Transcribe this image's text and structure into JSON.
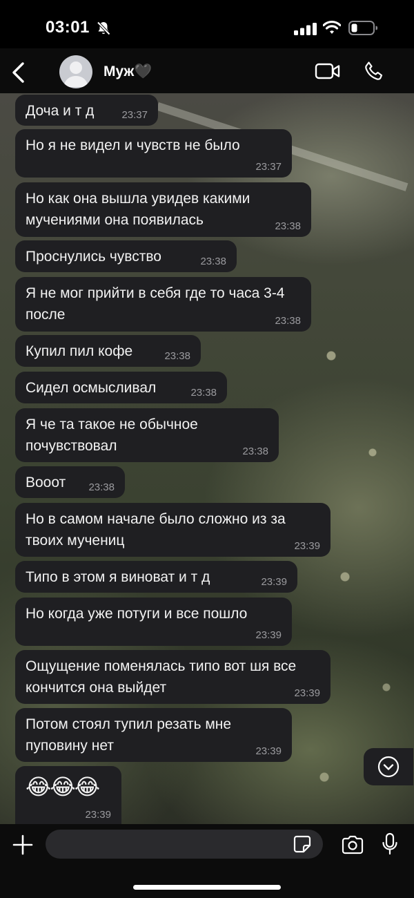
{
  "status_bar": {
    "time": "03:01"
  },
  "chat": {
    "contact_name": "Муж🖤"
  },
  "messages": [
    {
      "text": "Доча и т д",
      "time": "23:37"
    },
    {
      "text": "Но я не видел и чувств не было",
      "time": "23:37"
    },
    {
      "text": "Но как она вышла увидев какими мучениями она появилась",
      "time": "23:38"
    },
    {
      "text": "Проснулись чувство",
      "time": "23:38"
    },
    {
      "text": "Я не мог прийти в себя где то часа 3-4 после",
      "time": "23:38"
    },
    {
      "text": "Купил пил кофе",
      "time": "23:38"
    },
    {
      "text": "Сидел осмысливал",
      "time": "23:38"
    },
    {
      "text": "Я че та такое не обычное почувствовал",
      "time": "23:38"
    },
    {
      "text": "Вооот",
      "time": "23:38"
    },
    {
      "text": "Но в самом начале было сложно из за твоих мучениц",
      "time": "23:39"
    },
    {
      "text": "Типо в этом я виноват и т д",
      "time": "23:39"
    },
    {
      "text": "Но когда уже потуги и все пошло",
      "time": "23:39"
    },
    {
      "text": "Ощущение поменялась типо вот шя все кончится она выйдет",
      "time": "23:39"
    },
    {
      "text": "Потом стоял тупил резать мне пуповину нет",
      "time": "23:39"
    },
    {
      "text": "😂😂😂",
      "time": "23:39"
    }
  ],
  "input": {
    "placeholder": ""
  },
  "colors": {
    "bubble": "#1f1f22",
    "background": "#000000",
    "timestamp": "#9b9b9f"
  }
}
